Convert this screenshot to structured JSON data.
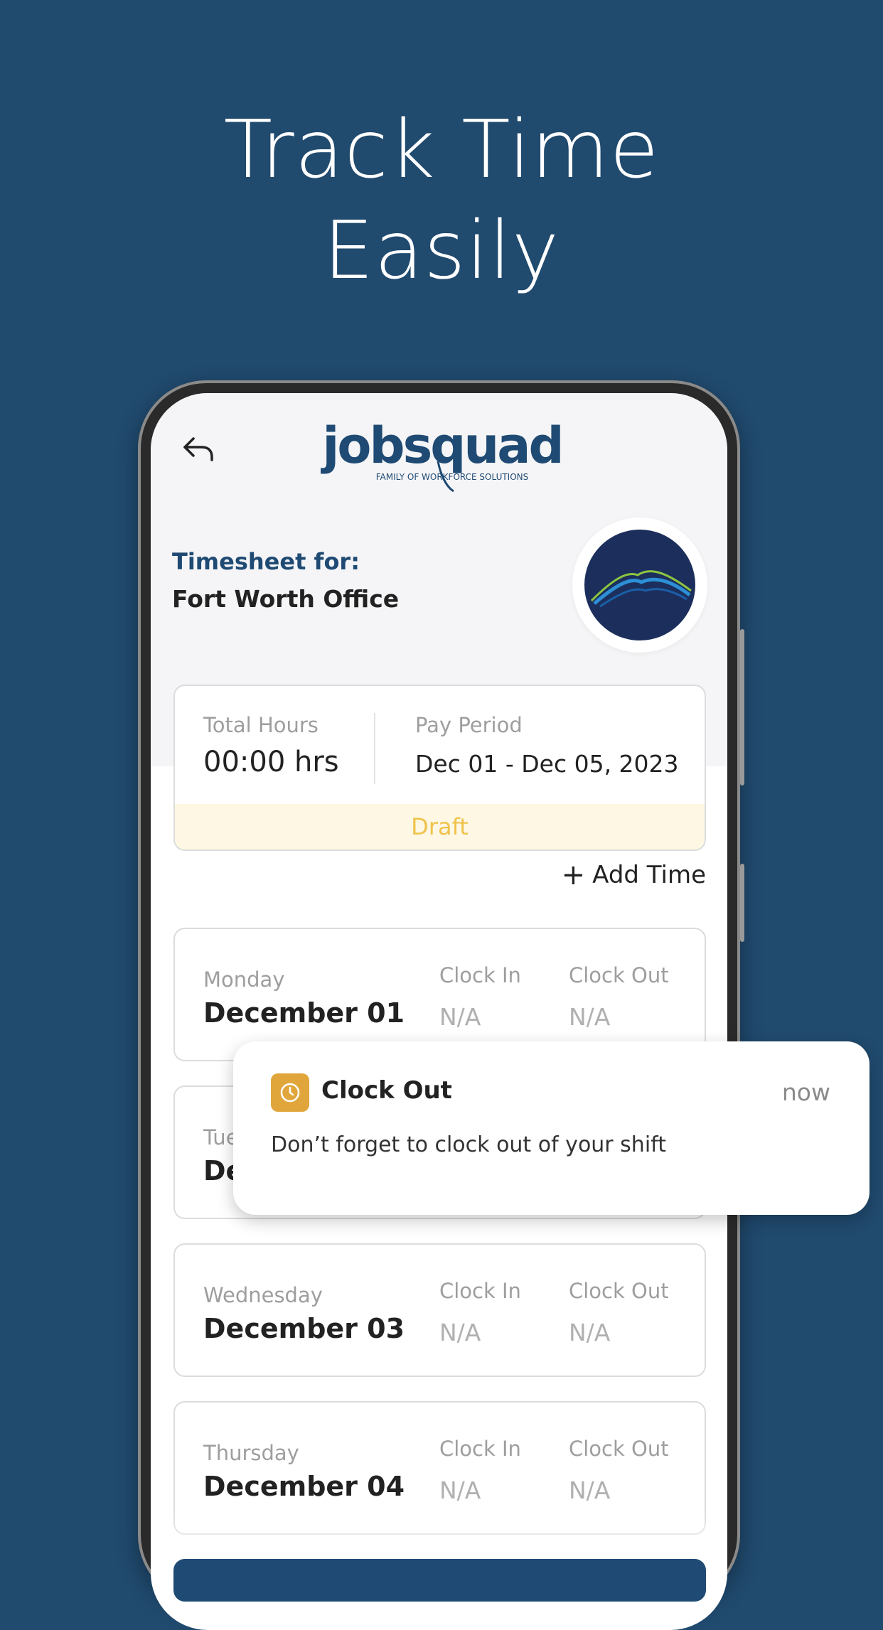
{
  "headline": {
    "line1": "Track Time",
    "line2": "Easily"
  },
  "app": {
    "logo_text": "jobsquad",
    "logo_tagline": "FAMILY OF WORKFORCE SOLUTIONS",
    "timesheet_label": "Timesheet for:",
    "office": "Fort Worth Office"
  },
  "summary": {
    "total_hours_label": "Total Hours",
    "total_hours": "00:00 hrs",
    "pay_period_label": "Pay Period",
    "pay_period": "Dec 01 - Dec 05, 2023",
    "status": "Draft"
  },
  "add_time_label": "Add Time",
  "days": [
    {
      "day": "Monday",
      "date": "December 01",
      "clock_in_label": "Clock In",
      "clock_in": "N/A",
      "clock_out_label": "Clock Out",
      "clock_out": "N/A"
    },
    {
      "day": "Tue",
      "date": "De",
      "clock_in_label": "",
      "clock_in": "",
      "clock_out_label": "",
      "clock_out": ""
    },
    {
      "day": "Wednesday",
      "date": "December 03",
      "clock_in_label": "Clock In",
      "clock_in": "N/A",
      "clock_out_label": "Clock Out",
      "clock_out": "N/A"
    },
    {
      "day": "Thursday",
      "date": "December 04",
      "clock_in_label": "Clock In",
      "clock_in": "N/A",
      "clock_out_label": "Clock Out",
      "clock_out": "N/A"
    }
  ],
  "notification": {
    "title": "Clock Out",
    "time": "now",
    "body": "Don’t forget to clock out of your shift"
  },
  "colors": {
    "background": "#204a6e",
    "brand": "#1f4a73",
    "draft": "#efc34c",
    "notification_icon": "#e0a63c"
  }
}
